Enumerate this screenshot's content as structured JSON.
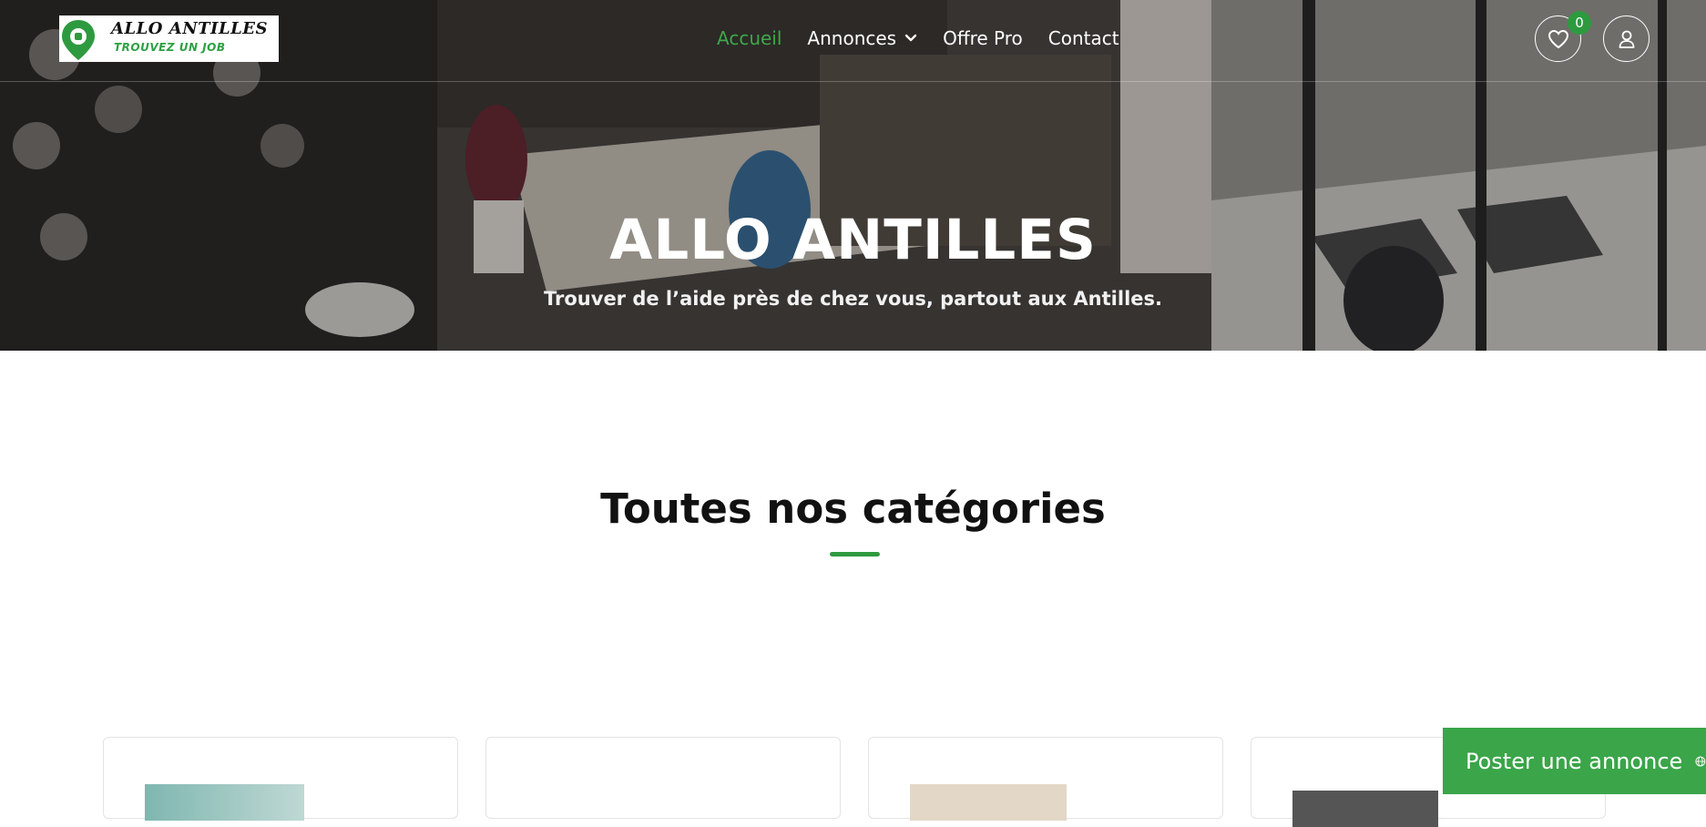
{
  "logo": {
    "title": "ALLO ANTILLES",
    "tagline": "TROUVEZ UN JOB"
  },
  "nav": {
    "items": [
      {
        "label": "Accueil",
        "active": true
      },
      {
        "label": "Annonces",
        "dropdown": true
      },
      {
        "label": "Offre Pro"
      },
      {
        "label": "Contact"
      }
    ],
    "wishlist_count": "0",
    "icons": [
      "heart-icon",
      "user-icon",
      "chevron-down-icon"
    ]
  },
  "hero": {
    "title": "ALLO ANTILLES",
    "subtitle": "Trouver de l’aide près de chez vous, partout aux Antilles."
  },
  "categories": {
    "title": "Toutes nos catégories"
  },
  "cta": {
    "label": "Poster une annonce",
    "icon": "globe-icon"
  },
  "colors": {
    "accent": "#3aa549",
    "active_nav": "#3ea84a",
    "badge": "#2e9a3f"
  }
}
